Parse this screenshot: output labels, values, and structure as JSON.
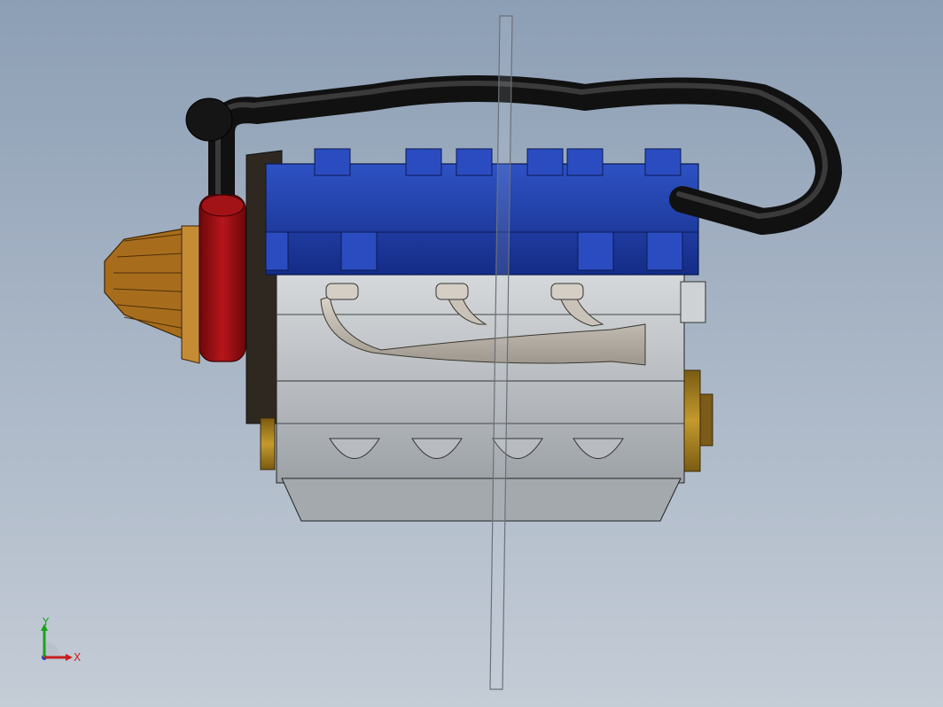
{
  "viewport": {
    "background_top": "#8d9fb5",
    "background_bottom": "#c4ccd6"
  },
  "model": {
    "parts": [
      "breather-hose",
      "valve-cover",
      "air-filter",
      "throttle-body",
      "exhaust-manifold",
      "engine-block",
      "oil-pan",
      "crank-pulley",
      "section-plane"
    ],
    "colors": {
      "hose": "#141414",
      "valve_cover": "#1f3da3",
      "air_filter": "#a86d1c",
      "throttle_body": "#8e0d10",
      "block": "#c2c6ca",
      "manifold": "#bcb5ab",
      "pulley": "#9a7b1e"
    }
  },
  "triad": {
    "x_label": "X",
    "y_label": "Y",
    "x_color": "#c81e1e",
    "y_color": "#1aa31a",
    "z_color": "#1a3fc8"
  }
}
